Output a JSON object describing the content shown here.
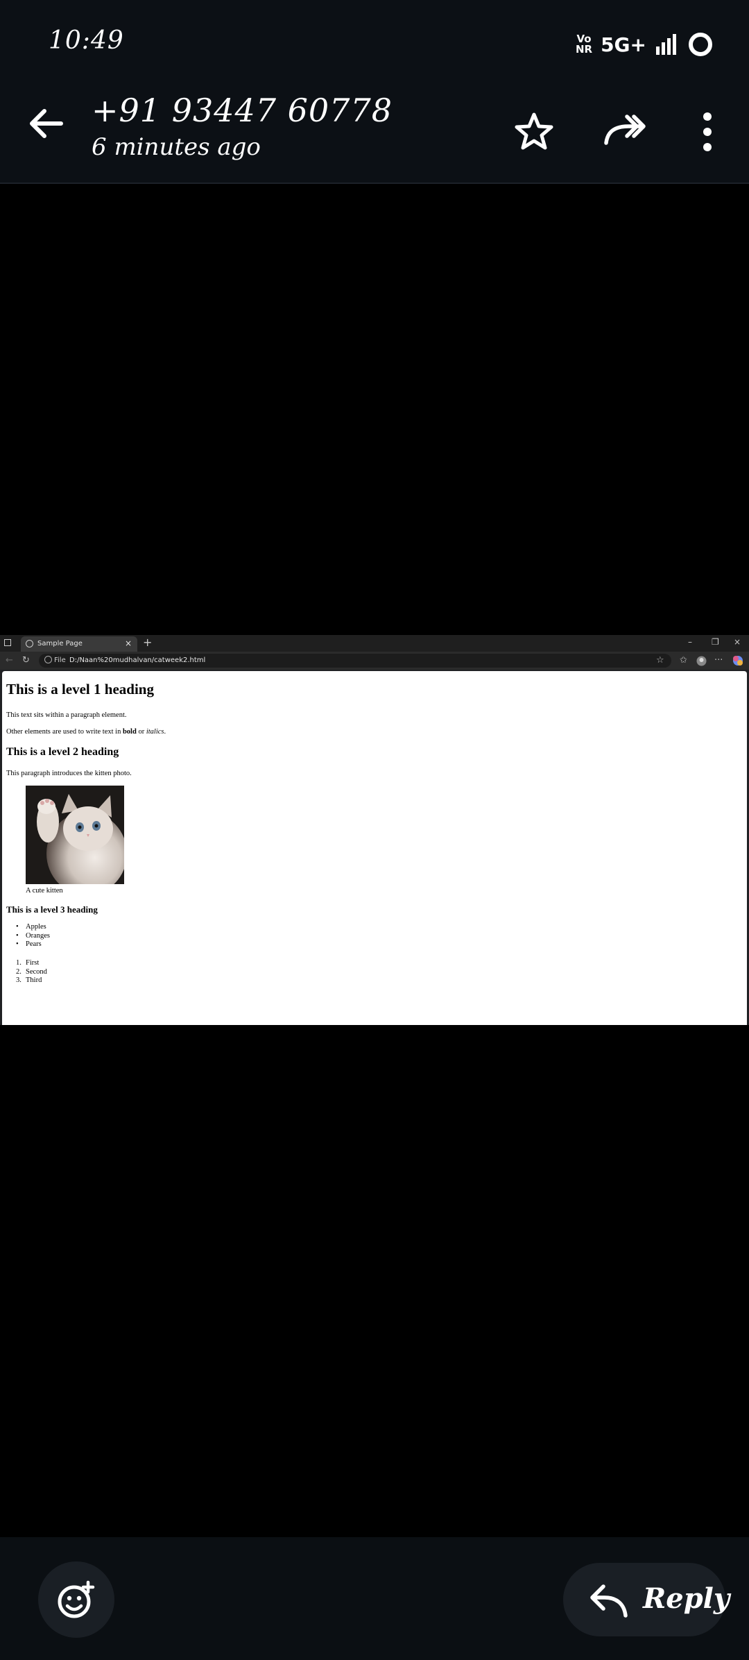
{
  "status_bar": {
    "time": "10:49",
    "vonr_top": "Vo",
    "vonr_bottom": "NR",
    "network": "5G+"
  },
  "header": {
    "contact": "+91 93447 60778",
    "subtitle": "6 minutes ago",
    "icons": [
      "back-arrow-icon",
      "star-icon",
      "forward-icon",
      "more-vert-icon"
    ]
  },
  "browser": {
    "tab_title": "Sample Page",
    "tab_close": "×",
    "new_tab": "+",
    "address_label": "File",
    "url": "D:/Naan%20mudhalvan/catweek2.html",
    "window_controls": [
      "–",
      "❐",
      "×"
    ]
  },
  "page": {
    "h1": "This is a level 1 heading",
    "p1": "This text sits within a paragraph element.",
    "p2_before": "Other elements are used to write text in ",
    "p2_bold": "bold",
    "p2_middle": " or ",
    "p2_italic": "italics",
    "p2_after": ".",
    "h2": "This is a level 2 heading",
    "p3": "This paragraph introduces the kitten photo.",
    "caption": "A cute kitten",
    "h3": "This is a level 3 heading",
    "unordered": [
      "Apples",
      "Oranges",
      "Pears"
    ],
    "ordered": [
      "First",
      "Second",
      "Third"
    ]
  },
  "footer": {
    "reply_label": "Reply"
  }
}
